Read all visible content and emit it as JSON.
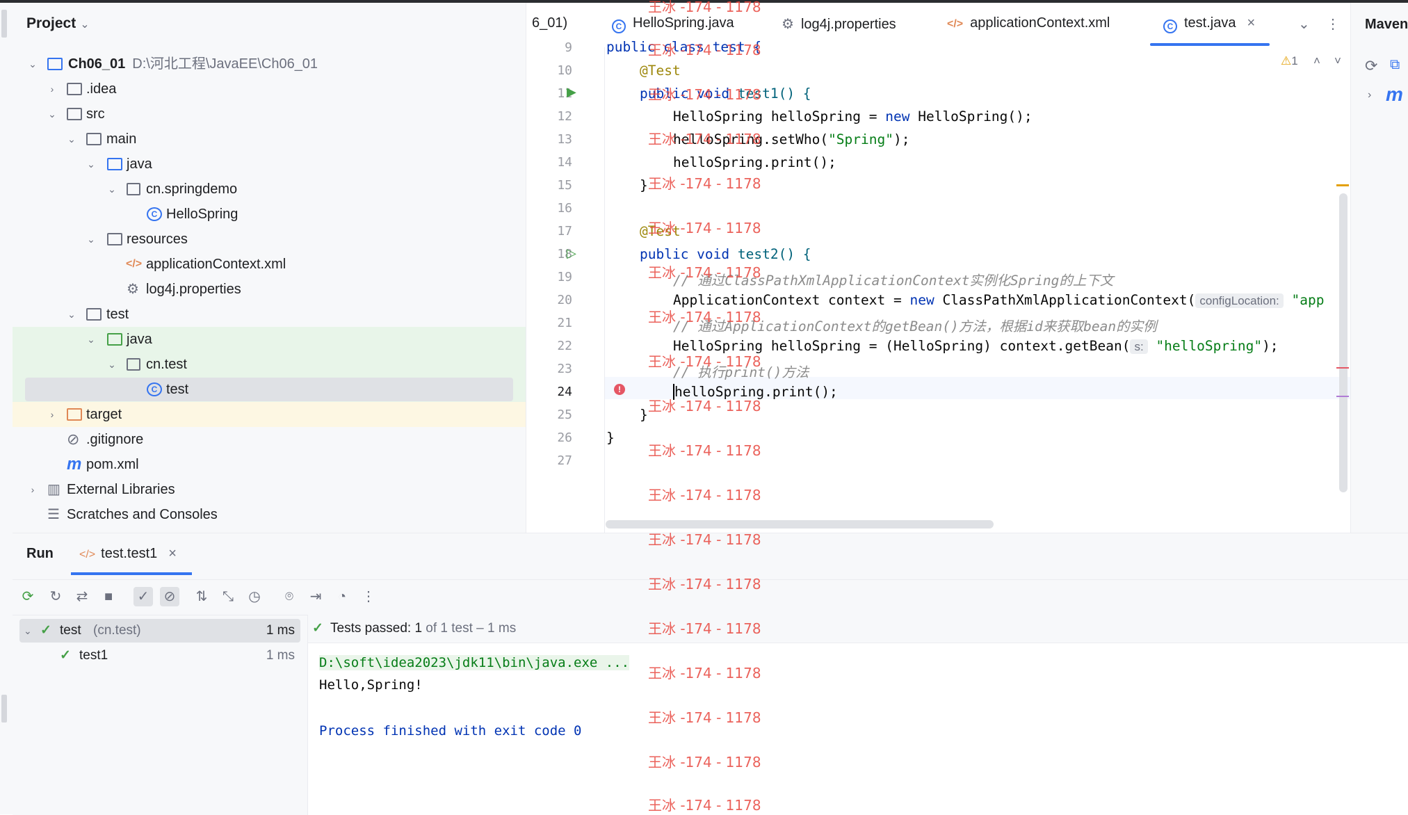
{
  "project": {
    "header": "Project",
    "tree": [
      {
        "label": "Ch06_01",
        "path": "D:\\河北工程\\JavaEE\\Ch06_01",
        "icon": "module-folder-icon"
      },
      {
        "label": ".idea",
        "icon": "folder-icon"
      },
      {
        "label": "src",
        "icon": "folder-icon"
      },
      {
        "label": "main",
        "icon": "folder-icon"
      },
      {
        "label": "java",
        "icon": "source-folder-icon"
      },
      {
        "label": "cn.springdemo",
        "icon": "package-icon"
      },
      {
        "label": "HelloSpring",
        "icon": "class-icon"
      },
      {
        "label": "resources",
        "icon": "resources-folder-icon"
      },
      {
        "label": "applicationContext.xml",
        "icon": "xml-file-icon"
      },
      {
        "label": "log4j.properties",
        "icon": "properties-file-icon"
      },
      {
        "label": "test",
        "icon": "folder-icon"
      },
      {
        "label": "java",
        "icon": "test-source-folder-icon"
      },
      {
        "label": "cn.test",
        "icon": "package-icon"
      },
      {
        "label": "test",
        "icon": "class-icon"
      },
      {
        "label": "target",
        "icon": "excluded-folder-icon"
      },
      {
        "label": ".gitignore",
        "icon": "ignored-file-icon"
      },
      {
        "label": "pom.xml",
        "icon": "maven-file-icon"
      },
      {
        "label": "External Libraries",
        "icon": "libraries-icon"
      },
      {
        "label": "Scratches and Consoles",
        "icon": "scratches-icon"
      }
    ]
  },
  "tabs": [
    {
      "label": "6_01)",
      "icon": ""
    },
    {
      "label": "HelloSpring.java",
      "icon": "class-icon"
    },
    {
      "label": "log4j.properties",
      "icon": "gear-icon"
    },
    {
      "label": "applicationContext.xml",
      "icon": "xml-file-icon"
    },
    {
      "label": "test.java",
      "icon": "class-icon",
      "active": true
    }
  ],
  "maven_label": "Maven",
  "editor": {
    "warning_count": "1",
    "lines": [
      {
        "n": "9"
      },
      {
        "n": "10"
      },
      {
        "n": "11"
      },
      {
        "n": "12"
      },
      {
        "n": "13"
      },
      {
        "n": "14"
      },
      {
        "n": "15"
      },
      {
        "n": "16"
      },
      {
        "n": "17"
      },
      {
        "n": "18"
      },
      {
        "n": "19"
      },
      {
        "n": "20"
      },
      {
        "n": "21"
      },
      {
        "n": "22"
      },
      {
        "n": "23"
      },
      {
        "n": "24"
      },
      {
        "n": "25"
      },
      {
        "n": "26"
      },
      {
        "n": "27"
      }
    ],
    "code": {
      "l9": "public class test {",
      "l10": "@Test",
      "l11a": "public void ",
      "l11b": "test1() {",
      "l12a": "HelloSpring helloSpring = ",
      "l12b": "new",
      "l12c": " HelloSpring();",
      "l13a": "helloSpring.setWho(",
      "l13b": "\"Spring\"",
      "l13c": ");",
      "l14": "helloSpring.print();",
      "l15": "}",
      "l17": "@Test",
      "l18a": "public void ",
      "l18b": "test2() {",
      "l19": "// 通过ClassPathXmlApplicationContext实例化Spring的上下文",
      "l20a": "ApplicationContext context = ",
      "l20b": "new",
      "l20c": " ClassPathXmlApplicationContext(",
      "l20hint": "configLocation:",
      "l20d": "\"app",
      "l21": "// 通过ApplicationContext的getBean()方法，根据id来获取bean的实例",
      "l22a": "HelloSpring helloSpring = (HelloSpring) context.getBean(",
      "l22hint": "s:",
      "l22b": "\"helloSpring\"",
      "l22c": ");",
      "l23": "// 执行print()方法",
      "l24": "helloSpring.print();",
      "l25": "}",
      "l26": "}"
    }
  },
  "run": {
    "title": "Run",
    "tab": "test.test1",
    "results": [
      {
        "name": "test",
        "detail": "(cn.test)",
        "time": "1 ms"
      },
      {
        "name": "test1",
        "detail": "",
        "time": "1 ms"
      }
    ],
    "status_bold": "Tests passed: 1",
    "status_rest": " of 1 test – 1 ms",
    "console": [
      "D:\\soft\\idea2023\\jdk11\\bin\\java.exe ...",
      "Hello,Spring!",
      "",
      "Process finished with exit code 0"
    ]
  },
  "watermark": "王冰 -174 - 1178",
  "colors": {
    "accent": "#3574f0",
    "success": "#45a047",
    "error": "#e55765",
    "watermark": "#e8473f"
  }
}
